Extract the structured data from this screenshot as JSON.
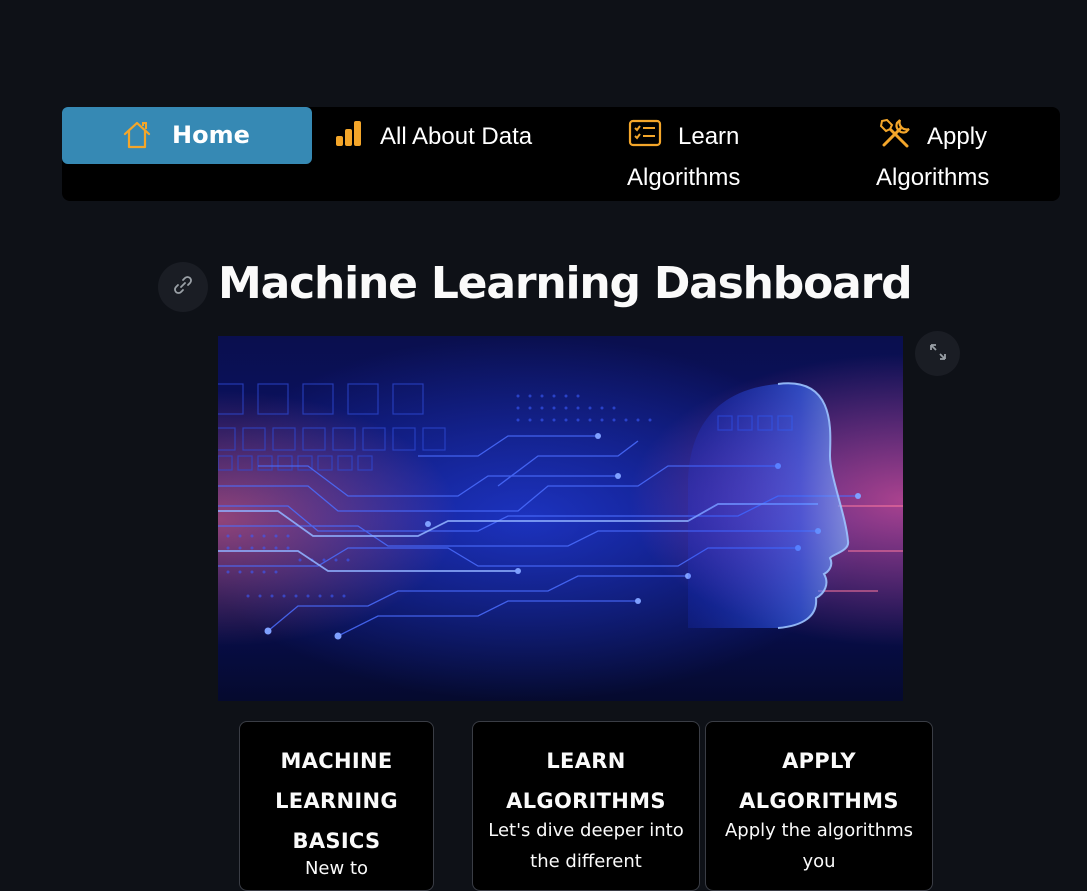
{
  "nav": {
    "items": [
      {
        "label": "Home",
        "icon": "home-icon",
        "active": true
      },
      {
        "label": "All About Data",
        "icon": "bar-chart-icon",
        "active": false
      },
      {
        "label_line1": "Learn",
        "label_line2": "Algorithms",
        "icon": "list-card-icon",
        "active": false
      },
      {
        "label_line1": "Apply",
        "label_line2": "Algorithms",
        "icon": "tools-icon",
        "active": false
      }
    ],
    "active_color": "#3689b4",
    "icon_color": "#f4a62a"
  },
  "title": "Machine Learning Dashboard",
  "hero": {
    "icons": [
      "link-icon",
      "fullscreen-icon"
    ]
  },
  "cards": [
    {
      "title": "MACHINE LEARNING BASICS",
      "text": "New to"
    },
    {
      "title": "LEARN ALGORITHMS",
      "text": "Let's dive deeper into the different"
    },
    {
      "title": "APPLY ALGORITHMS",
      "text": "Apply the algorithms you"
    }
  ],
  "colors": {
    "background": "#0e1117",
    "navbar": "#000000",
    "card": "#000000"
  }
}
